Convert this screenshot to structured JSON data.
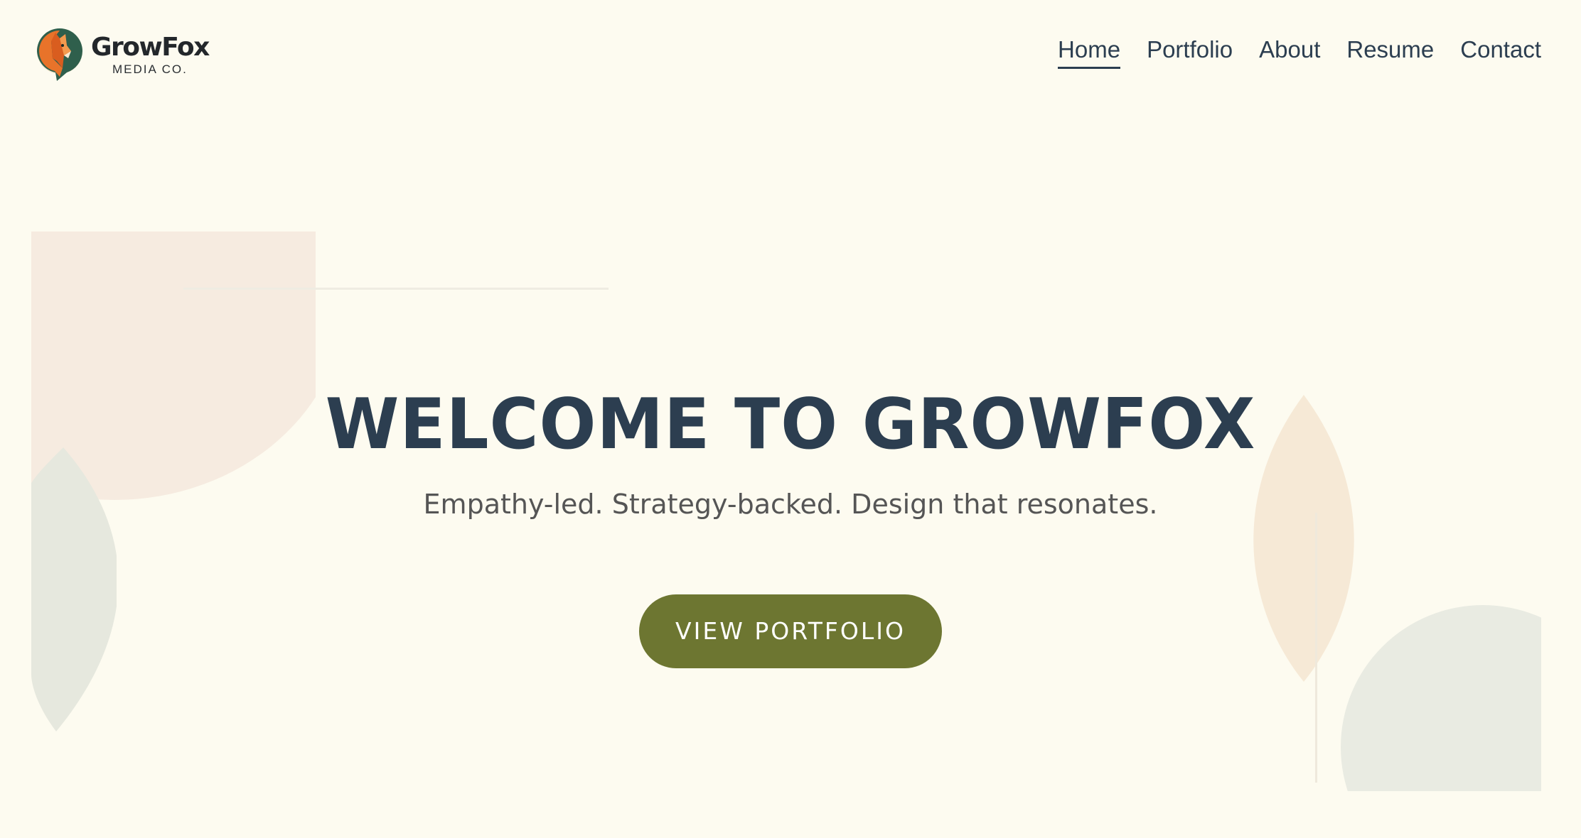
{
  "brand": {
    "name": "GrowFox",
    "tagline": "MEDIA CO.",
    "logo_icon": "fox-logo-icon"
  },
  "nav": {
    "items": [
      {
        "label": "Home",
        "active": true
      },
      {
        "label": "Portfolio",
        "active": false
      },
      {
        "label": "About",
        "active": false
      },
      {
        "label": "Resume",
        "active": false
      },
      {
        "label": "Contact",
        "active": false
      }
    ]
  },
  "hero": {
    "title": "WELCOME TO GROWFOX",
    "subtitle": "Empathy-led. Strategy-backed. Design that resonates.",
    "cta_label": "VIEW PORTFOLIO"
  },
  "colors": {
    "background": "#fdfbf0",
    "text_primary": "#2c3e50",
    "text_secondary": "#555555",
    "accent_olive": "#6d7631",
    "fox_orange": "#e8732a",
    "deco_peach": "#f6ebe0",
    "deco_sage": "#e9ebe2"
  }
}
